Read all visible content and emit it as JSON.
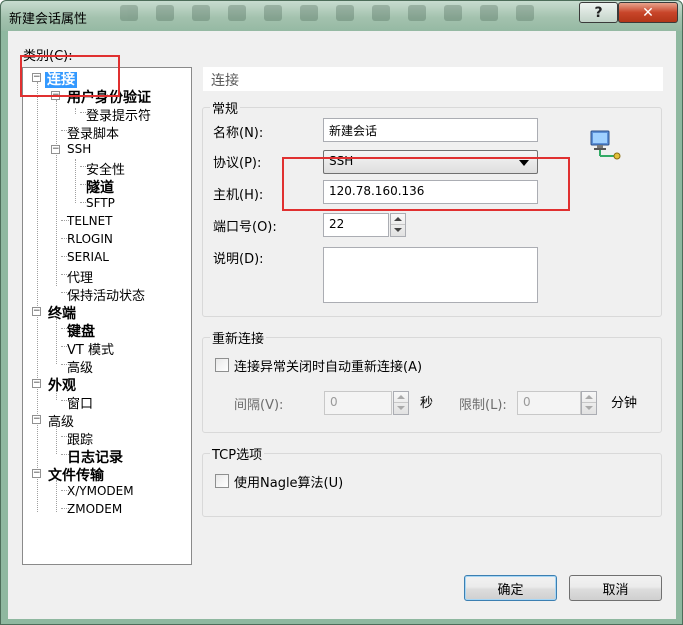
{
  "window": {
    "title": "新建会话属性",
    "help_label": "?",
    "close_label": "✕"
  },
  "category_label": "类别(C):",
  "tree": {
    "connection": "连接",
    "auth": "用户身份验证",
    "login_prompt": "登录提示符",
    "login_script": "登录脚本",
    "ssh": "SSH",
    "security": "安全性",
    "tunnel": "隧道",
    "sftp": "SFTP",
    "telnet": "TELNET",
    "rlogin": "RLOGIN",
    "serial": "SERIAL",
    "proxy": "代理",
    "keepalive": "保持活动状态",
    "terminal": "终端",
    "keyboard": "键盘",
    "vt_mode": "VT 模式",
    "terminal_advanced": "高级",
    "appearance": "外观",
    "window": "窗口",
    "advanced": "高级",
    "trace": "跟踪",
    "log": "日志记录",
    "file_transfer": "文件传输",
    "xymodem": "X/YMODEM",
    "zmodem": "ZMODEM"
  },
  "panel": {
    "header": "连接",
    "general": {
      "title": "常规",
      "name_label": "名称(N):",
      "name_value": "新建会话",
      "protocol_label": "协议(P):",
      "protocol_value": "SSH",
      "host_label": "主机(H):",
      "host_value": "120.78.160.136",
      "port_label": "端口号(O):",
      "port_value": "22",
      "desc_label": "说明(D):",
      "desc_value": ""
    },
    "reconnect": {
      "title": "重新连接",
      "auto_reconnect_label": "连接异常关闭时自动重新连接(A)",
      "interval_label": "间隔(V):",
      "interval_value": "0",
      "interval_unit": "秒",
      "limit_label": "限制(L):",
      "limit_value": "0",
      "limit_unit": "分钟"
    },
    "tcp": {
      "title": "TCP选项",
      "nagle_label": "使用Nagle算法(U)"
    }
  },
  "buttons": {
    "ok": "确定",
    "cancel": "取消"
  },
  "colors": {
    "selection": "#3399ff",
    "annotation": "#e03030",
    "title_bar": "#a3c2ae",
    "close_button": "#c8452a"
  },
  "icons": {
    "network": "network-computer-icon"
  }
}
